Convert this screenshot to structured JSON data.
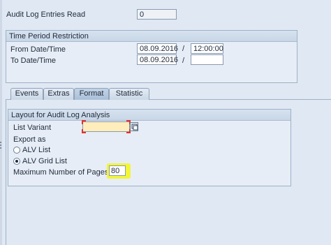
{
  "audit_log": {
    "label": "Audit Log Entries Read",
    "value": "0"
  },
  "time_period": {
    "title": "Time Period Restriction",
    "from_label": "From Date/Time",
    "from_date": "08.09.2016",
    "from_sep": "/",
    "from_time": "12:00:00",
    "to_label": "To Date/Time",
    "to_date": "08.09.2016",
    "to_sep": "/",
    "to_time": ""
  },
  "tabs": [
    {
      "label": "Events",
      "active": false
    },
    {
      "label": "Extras",
      "active": false
    },
    {
      "label": "Format",
      "active": true
    },
    {
      "label": "Statistic",
      "active": false
    }
  ],
  "layout": {
    "title": "Layout for Audit Log Analysis",
    "list_variant_label": "List Variant",
    "list_variant_value": "",
    "export_label": "Export as",
    "options": [
      {
        "label": "ALV List",
        "checked": false
      },
      {
        "label": "ALV Grid List",
        "checked": true
      }
    ],
    "max_pages_label": "Maximum Number of Pages",
    "max_pages_value": "80"
  },
  "colors": {
    "background": "#dfe8f3",
    "highlight": "#f2f53a",
    "required_field": "#ffeebb",
    "marker_red": "#e53030"
  },
  "icons": [
    "value-help-icon"
  ]
}
